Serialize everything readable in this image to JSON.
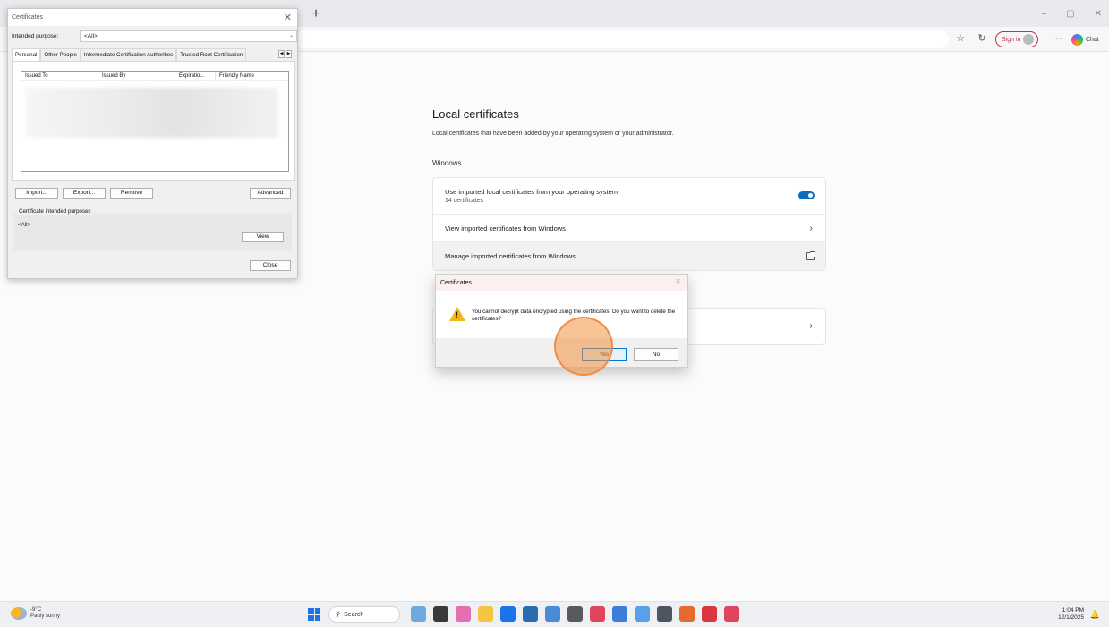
{
  "browser": {
    "new_tab": "+",
    "signin": "Sign in",
    "more": "···",
    "chat": "Chat",
    "win_min": "–",
    "win_max": "▢",
    "win_close": "✕"
  },
  "settings": {
    "title": "Local certificates",
    "description": "Local certificates that have been added by your operating system or your administrator.",
    "section": "Windows",
    "rows": [
      {
        "label": "Use imported local certificates from your operating system",
        "sub": "14 certificates"
      },
      {
        "label": "View imported certificates from Windows"
      },
      {
        "label": "Manage imported certificates from Windows"
      }
    ],
    "toggle_on": true
  },
  "certwin": {
    "title": "Certificates",
    "close": "✕",
    "purpose_label": "Intended purpose:",
    "purpose_value": "<All>",
    "tabs": [
      "Personal",
      "Other People",
      "Intermediate Certification Authorities",
      "Trusted Root Certification"
    ],
    "columns": [
      "Issued To",
      "Issued By",
      "Expiratio...",
      "Friendly Name"
    ],
    "buttons": {
      "import": "Import...",
      "export": "Export...",
      "remove": "Remove",
      "advanced": "Advanced",
      "view": "View",
      "close": "Close"
    },
    "group_label": "Certificate intended purposes",
    "group_value": "<All>"
  },
  "dialog": {
    "title": "Certificates",
    "message": "You cannot decrypt data encrypted using the certificates. Do you want to delete the certificates?",
    "yes": "Yes",
    "no": "No"
  },
  "taskbar": {
    "temp": "-9°C",
    "condition": "Partly sunny",
    "search": "Search",
    "time": "1:04 PM",
    "date": "12/1/2025",
    "app_colors": [
      "#6fa8dc",
      "#3a3a3a",
      "#e36fb0",
      "#f4c542",
      "#1a73e8",
      "#2b6cb0",
      "#4a8bd6",
      "#5a5a5a",
      "#e0455e",
      "#3c7dd9",
      "#5aa0e8",
      "#4b5563",
      "#e26b2d",
      "#d9363e",
      "#e0455e"
    ]
  }
}
